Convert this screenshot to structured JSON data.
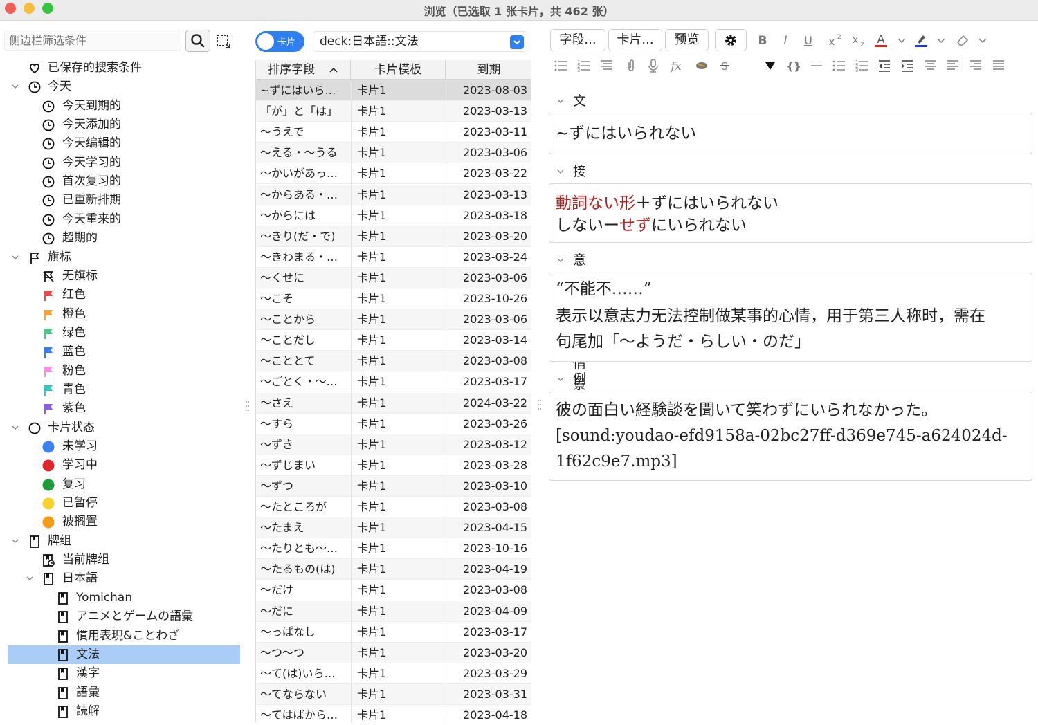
{
  "window": {
    "title": "浏览（已选取 1 张卡片，共 462 张）"
  },
  "sidebar": {
    "search_placeholder": "侧边栏筛选条件",
    "items": [
      {
        "label": "已保存的搜索条件",
        "icon": "heart-icon",
        "level": 0,
        "chev": false
      },
      {
        "label": "今天",
        "icon": "clock-icon",
        "level": 0,
        "chev": true
      },
      {
        "label": "今天到期的",
        "icon": "clock-icon",
        "level": 1
      },
      {
        "label": "今天添加的",
        "icon": "clock-icon",
        "level": 1
      },
      {
        "label": "今天编辑的",
        "icon": "clock-icon",
        "level": 1
      },
      {
        "label": "今天学习的",
        "icon": "clock-icon",
        "level": 1
      },
      {
        "label": "首次复习的",
        "icon": "clock-icon",
        "level": 1
      },
      {
        "label": "已重新排期",
        "icon": "clock-icon",
        "level": 1
      },
      {
        "label": "今天重来的",
        "icon": "clock-icon",
        "level": 1
      },
      {
        "label": "超期的",
        "icon": "clock-icon",
        "level": 1
      },
      {
        "label": "旗标",
        "icon": "flag-outline-icon",
        "level": 0,
        "chev": true
      },
      {
        "label": "无旗标",
        "icon": "no-flag-icon",
        "level": 1
      },
      {
        "label": "红色",
        "icon": "flag-icon",
        "level": 1,
        "color": "#e84a4a"
      },
      {
        "label": "橙色",
        "icon": "flag-icon",
        "level": 1,
        "color": "#f3a33c"
      },
      {
        "label": "绿色",
        "icon": "flag-icon",
        "level": 1,
        "color": "#4fc68a"
      },
      {
        "label": "蓝色",
        "icon": "flag-icon",
        "level": 1,
        "color": "#3b7de8"
      },
      {
        "label": "粉色",
        "icon": "flag-icon",
        "level": 1,
        "color": "#f38ddc"
      },
      {
        "label": "青色",
        "icon": "flag-icon",
        "level": 1,
        "color": "#2fc7c0"
      },
      {
        "label": "紫色",
        "icon": "flag-icon",
        "level": 1,
        "color": "#8a5fe6"
      },
      {
        "label": "卡片状态",
        "icon": "circle-outline-icon",
        "level": 0,
        "chev": true
      },
      {
        "label": "未学习",
        "icon": "dot-icon",
        "level": 1,
        "color": "#3b82f0"
      },
      {
        "label": "学习中",
        "icon": "dot-icon",
        "level": 1,
        "color": "#e0262b"
      },
      {
        "label": "复习",
        "icon": "dot-icon",
        "level": 1,
        "color": "#1f9a3a"
      },
      {
        "label": "已暂停",
        "icon": "dot-icon",
        "level": 1,
        "color": "#f7d22e"
      },
      {
        "label": "被搁置",
        "icon": "dot-icon",
        "level": 1,
        "color": "#f59b1a"
      },
      {
        "label": "牌组",
        "icon": "deck-icon",
        "level": 0,
        "chev": true
      },
      {
        "label": "当前牌组",
        "icon": "current-deck-icon",
        "level": 1
      },
      {
        "label": "日本語",
        "icon": "deck-icon",
        "level": 1,
        "chev": true
      },
      {
        "label": "Yomichan",
        "icon": "deck-icon",
        "level": 2
      },
      {
        "label": "アニメとゲームの語彙",
        "icon": "deck-icon",
        "level": 2
      },
      {
        "label": "慣用表現&ことわざ",
        "icon": "deck-icon",
        "level": 2
      },
      {
        "label": "文法",
        "icon": "deck-icon",
        "level": 2,
        "selected": true
      },
      {
        "label": "漢字",
        "icon": "deck-icon",
        "level": 2
      },
      {
        "label": "語彙",
        "icon": "deck-icon",
        "level": 2
      },
      {
        "label": "読解",
        "icon": "deck-icon",
        "level": 2
      }
    ]
  },
  "browser": {
    "toggle_label": "卡片",
    "search_value": "deck:日本語::文法",
    "columns": [
      "排序字段",
      "卡片模板",
      "到期"
    ],
    "rows": [
      [
        "~ずにはいら…",
        "卡片1",
        "2023-08-03"
      ],
      [
        "「が」と「は」",
        "卡片1",
        "2023-03-13"
      ],
      [
        "～うえで",
        "卡片1",
        "2023-03-11"
      ],
      [
        "～える・～うる",
        "卡片1",
        "2023-03-06"
      ],
      [
        "～かいがあっ…",
        "卡片1",
        "2023-03-22"
      ],
      [
        "～からある・…",
        "卡片1",
        "2023-03-13"
      ],
      [
        "～からには",
        "卡片1",
        "2023-03-18"
      ],
      [
        "～きり(だ・で)",
        "卡片1",
        "2023-03-20"
      ],
      [
        "～きわまる・…",
        "卡片1",
        "2023-03-24"
      ],
      [
        "～くせに",
        "卡片1",
        "2023-03-06"
      ],
      [
        "～こそ",
        "卡片1",
        "2023-10-26"
      ],
      [
        "～ことから",
        "卡片1",
        "2023-03-06"
      ],
      [
        "～ことだし",
        "卡片1",
        "2023-03-14"
      ],
      [
        "～こととて",
        "卡片1",
        "2023-03-08"
      ],
      [
        "～ごとく・～…",
        "卡片1",
        "2023-03-17"
      ],
      [
        "～さえ",
        "卡片1",
        "2024-03-22"
      ],
      [
        "～すら",
        "卡片1",
        "2023-03-26"
      ],
      [
        "～ずき",
        "卡片1",
        "2023-03-12"
      ],
      [
        "～ずじまい",
        "卡片1",
        "2023-03-28"
      ],
      [
        "～ずつ",
        "卡片1",
        "2023-03-10"
      ],
      [
        "～たところが",
        "卡片1",
        "2023-03-08"
      ],
      [
        "～たまえ",
        "卡片1",
        "2023-04-15"
      ],
      [
        "～たりとも～…",
        "卡片1",
        "2023-10-16"
      ],
      [
        "～たるもの(は)",
        "卡片1",
        "2023-04-19"
      ],
      [
        "～だけ",
        "卡片1",
        "2023-03-08"
      ],
      [
        "～だに",
        "卡片1",
        "2023-04-09"
      ],
      [
        "～っぱなし",
        "卡片1",
        "2023-03-17"
      ],
      [
        "～つ～つ",
        "卡片1",
        "2023-03-20"
      ],
      [
        "～て(は)いら…",
        "卡片1",
        "2023-03-29"
      ],
      [
        "～てならない",
        "卡片1",
        "2023-03-31"
      ],
      [
        "～てはばから…",
        "卡片1",
        "2023-04-18"
      ]
    ]
  },
  "editor": {
    "fields_button": "字段...",
    "cards_button": "卡片...",
    "preview_button": "预览",
    "fields": [
      {
        "name": "文法",
        "lines": [
          "~ずにはいられない"
        ]
      },
      {
        "name": "接続",
        "lines_rich": [
          [
            {
              "t": "動詞ない形",
              "red": true
            },
            {
              "t": "＋ずにはいられない",
              "red": false
            }
          ],
          [
            {
              "t": "しないー",
              "red": false
            },
            {
              "t": "せず",
              "red": true
            },
            {
              "t": "にいられない",
              "red": false
            }
          ]
        ]
      },
      {
        "name": "意味と使用情景",
        "lines": [
          "“不能不……”",
          "表示以意志力无法控制做某事的心情，用于第三人称时，需在",
          "句尾加「～ようだ・らしい・のだ」"
        ]
      },
      {
        "name": "例句",
        "lines": [
          "彼の面白い経験談を聞いて笑わずにいられなかった。",
          "[sound:youdao-efd9158a-02bc27ff-d369e745-a624024d-",
          "1f62c9e7.mp3]"
        ]
      }
    ]
  },
  "colors": {
    "accent": "#2f7ff3",
    "selection": "#a9cdf6",
    "red_text": "#b52323"
  }
}
